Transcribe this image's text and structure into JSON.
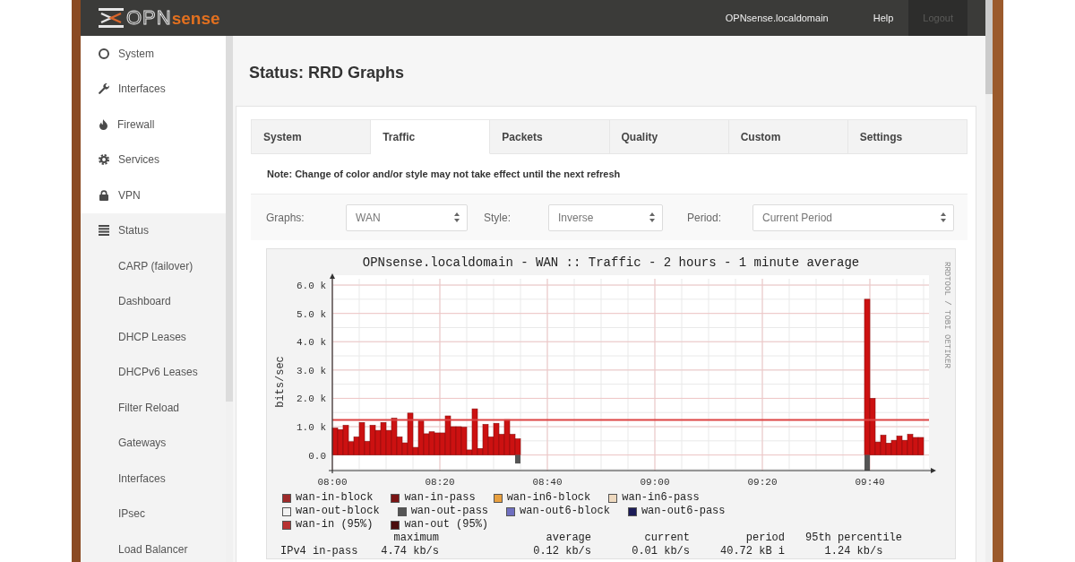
{
  "top_bar": {
    "logo": "OPN**sense**",
    "links": [
      {
        "label": "OPNsense.localdomain",
        "kind": "link"
      },
      {
        "label": "Help",
        "kind": "link"
      },
      {
        "label": "Logout",
        "kind": "button"
      }
    ]
  },
  "sidebar": {
    "items": [
      {
        "label": "System",
        "expanded": false
      },
      {
        "label": "Interfaces",
        "expanded": false
      },
      {
        "label": "Firewall",
        "expanded": false
      },
      {
        "label": "Services",
        "expanded": false
      },
      {
        "label": "VPN",
        "expanded": false
      },
      {
        "label": "Status",
        "expanded": true,
        "children": [
          {
            "label": "CARP (failover)"
          },
          {
            "label": "Dashboard"
          },
          {
            "label": "DHCP Leases"
          },
          {
            "label": "DHCPv6 Leases"
          },
          {
            "label": "Filter Reload"
          },
          {
            "label": "Gateways"
          },
          {
            "label": "Interfaces"
          },
          {
            "label": "IPsec"
          },
          {
            "label": "Load Balancer"
          }
        ]
      }
    ]
  },
  "page": {
    "title": "Status: RRD Graphs"
  },
  "tabs": [
    {
      "label": "System",
      "selected": false
    },
    {
      "label": "Traffic",
      "selected": true
    },
    {
      "label": "Packets",
      "selected": false
    },
    {
      "label": "Quality",
      "selected": false
    },
    {
      "label": "Custom",
      "selected": false
    },
    {
      "label": "Settings",
      "selected": false
    }
  ],
  "note": "Note: Change of color and/or style may not take effect until the next refresh",
  "filters": [
    {
      "label": "Graphs:",
      "value": "WAN"
    },
    {
      "label": "Style:",
      "value": "Inverse"
    },
    {
      "label": "Period:",
      "value": "Current Period"
    }
  ],
  "graph": {
    "chart_data": {
      "type": "bar",
      "title": "OPNsense.localdomain - WAN :: Traffic - 2 hours - 1 minute average",
      "ylabel": "bits/sec",
      "grid": true,
      "categories": [
        "08:00",
        null,
        null,
        null,
        null,
        null,
        null,
        null,
        null,
        null,
        null,
        null,
        null,
        null,
        null,
        null,
        null,
        null,
        null,
        null,
        "08:20",
        null,
        null,
        null,
        null,
        null,
        null,
        null,
        null,
        null,
        null,
        null,
        null,
        null,
        null,
        null,
        null,
        null,
        null,
        null,
        "08:40",
        null,
        null,
        null,
        null,
        null,
        null,
        null,
        null,
        null,
        null,
        null,
        null,
        null,
        null,
        null,
        null,
        null,
        null,
        null,
        "09:00",
        null,
        null,
        null,
        null,
        null,
        null,
        null,
        null,
        null,
        null,
        null,
        null,
        null,
        null,
        null,
        null,
        null,
        null,
        null,
        "09:20",
        null,
        null,
        null,
        null,
        null,
        null,
        null,
        null,
        null,
        null,
        null,
        null,
        null,
        null,
        null,
        null,
        null,
        null,
        null,
        "09:40",
        null,
        null,
        null,
        null,
        null,
        null,
        null,
        null,
        null
      ],
      "series": [
        {
          "color": "#cc1111",
          "values": [
            950,
            900,
            1050,
            470,
            640,
            1150,
            480,
            1050,
            870,
            1150,
            870,
            1300,
            640,
            430,
            1480,
            270,
            1200,
            750,
            820,
            780,
            780,
            1380,
            1000,
            1000,
            980,
            180,
            1630,
            230,
            1080,
            640,
            1120,
            730,
            1250,
            730,
            570,
            null,
            null,
            null,
            null,
            null,
            null,
            null,
            null,
            null,
            null,
            null,
            null,
            null,
            null,
            null,
            null,
            null,
            null,
            null,
            null,
            null,
            null,
            null,
            null,
            null,
            null,
            null,
            null,
            null,
            null,
            null,
            null,
            null,
            null,
            null,
            null,
            null,
            null,
            null,
            null,
            null,
            null,
            null,
            null,
            null,
            null,
            null,
            null,
            null,
            null,
            null,
            null,
            null,
            null,
            null,
            null,
            null,
            null,
            null,
            null,
            null,
            null,
            null,
            null,
            5500,
            2000,
            460,
            700,
            420,
            520,
            670,
            520,
            730,
            620,
            620
          ]
        },
        {
          "color": "#555555",
          "values": [
            null,
            null,
            null,
            null,
            null,
            null,
            null,
            null,
            null,
            null,
            null,
            null,
            null,
            null,
            null,
            null,
            null,
            null,
            null,
            null,
            null,
            null,
            null,
            null,
            null,
            null,
            null,
            null,
            null,
            null,
            null,
            null,
            null,
            null,
            -300,
            null,
            null,
            null,
            null,
            null,
            null,
            null,
            null,
            null,
            null,
            null,
            null,
            null,
            null,
            null,
            null,
            null,
            null,
            null,
            null,
            null,
            null,
            null,
            null,
            null,
            null,
            null,
            null,
            null,
            null,
            null,
            null,
            null,
            null,
            null,
            null,
            null,
            null,
            null,
            null,
            null,
            null,
            null,
            null,
            null,
            null,
            null,
            null,
            null,
            null,
            null,
            null,
            null,
            null,
            null,
            null,
            null,
            null,
            null,
            null,
            null,
            null,
            null,
            null,
            -550,
            null,
            null,
            null,
            null,
            null,
            null,
            null,
            null,
            null,
            null
          ]
        }
      ],
      "ylim": [
        -550,
        6350
      ],
      "yticks": [
        {
          "value": 0,
          "label": "0.0"
        },
        {
          "value": 1000,
          "label": "1.0 k"
        },
        {
          "value": 2000,
          "label": "2.0 k"
        },
        {
          "value": 3000,
          "label": "3.0 k"
        },
        {
          "value": 4000,
          "label": "4.0 k"
        },
        {
          "value": 5000,
          "label": "5.0 k"
        },
        {
          "value": 6000,
          "label": "6.0 k"
        }
      ],
      "ref_lines": [
        {
          "axis": "y",
          "value": 1240,
          "color": "#dd4444"
        }
      ]
    },
    "credit": "RRDTOOL / TOBI OETIKER",
    "legend_rows": [
      {
        "items": [
          {
            "name": "wan-in-block",
            "color": "#9e2a2a"
          },
          {
            "name": "wan-in-pass",
            "color": "#7a1414"
          },
          {
            "name": "wan-in6-block",
            "color": "#e8a040"
          },
          {
            "name": "wan-in6-pass",
            "color": "#eed9bf"
          }
        ]
      },
      {
        "items": [
          {
            "name": "wan-out-block",
            "color": "#f2f2f2"
          },
          {
            "name": "wan-out-pass",
            "color": "#555555"
          },
          {
            "name": "wan-out6-block",
            "color": "#6f6fc0"
          },
          {
            "name": "wan-out6-pass",
            "color": "#1c1c58"
          }
        ]
      },
      {
        "items": [
          {
            "name": "wan-in (95%)",
            "color": "#b83232"
          },
          {
            "name": "wan-out (95%)",
            "color": "#4a0c0c"
          }
        ]
      }
    ],
    "stats": {
      "columns": [
        "maximum",
        "average",
        "current",
        "period",
        "95th percentile"
      ],
      "rows": [
        {
          "label": "IPv4 in-pass",
          "values": [
            "4.74 kb/s",
            "0.12 kb/s",
            "0.01 kb/s",
            "40.72 kB i",
            "1.24 kb/s"
          ]
        }
      ]
    }
  }
}
